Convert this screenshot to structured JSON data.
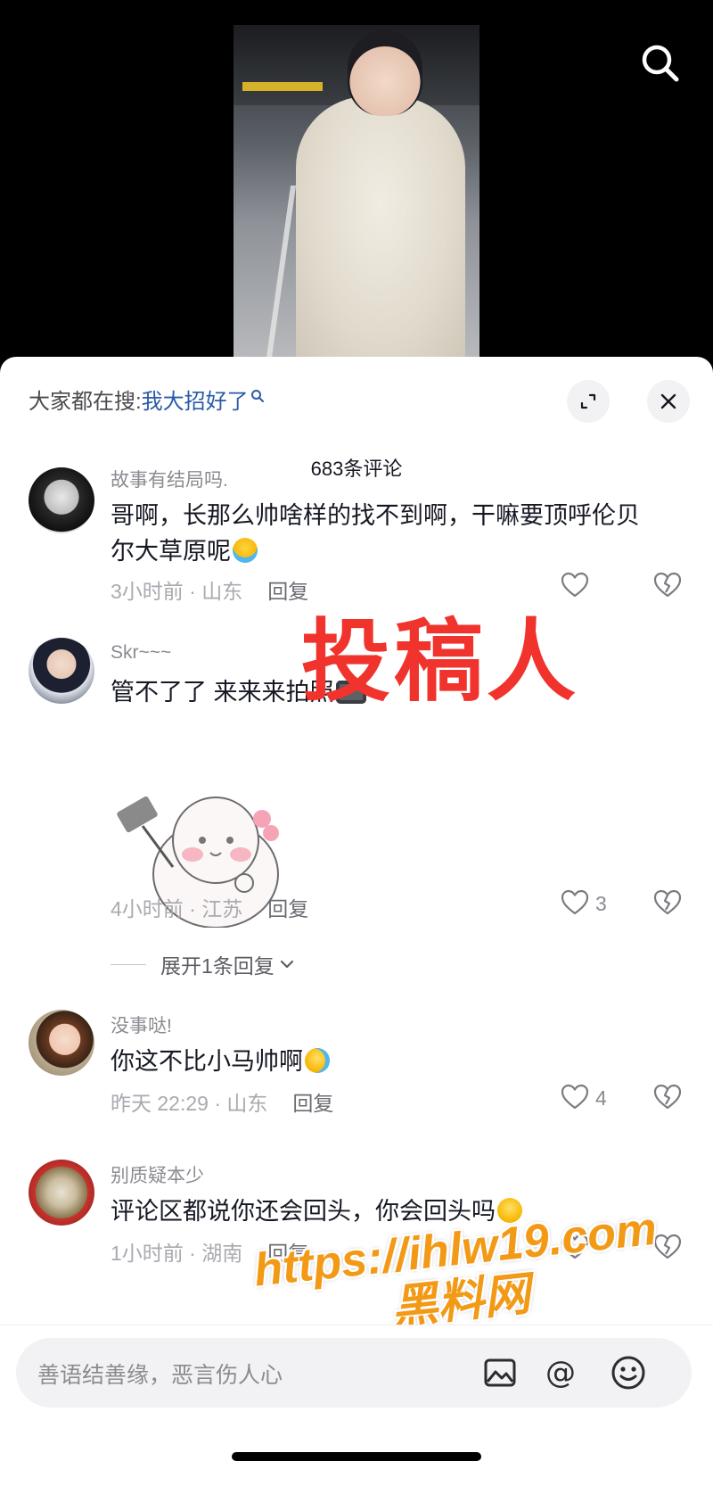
{
  "hot_search": {
    "prefix": "大家都在搜:",
    "query": "我大招好了"
  },
  "comment_count": "683条评论",
  "comments": [
    {
      "username": "故事有结局吗.",
      "text": "哥啊，长那么帅啥样的找不到啊，干嘛要顶呼伦贝尔大草原呢",
      "time_location": "3小时前 · 山东",
      "reply_label": "回复",
      "likes": ""
    },
    {
      "username": "Skr~~~",
      "text": "管不了了 来来来拍照",
      "time_location": "4小时前 · 江苏",
      "reply_label": "回复",
      "likes": "3",
      "expand_replies": "展开1条回复"
    },
    {
      "username": "没事哒!",
      "text": "你这不比小马帅啊",
      "time_location": "昨天 22:29 · 山东",
      "reply_label": "回复",
      "likes": "4"
    },
    {
      "username": "别质疑本少",
      "text": "评论区都说你还会回头，你会回头吗",
      "time_location": "1小时前 · 湖南",
      "reply_label": "回复",
      "likes": ""
    }
  ],
  "input": {
    "placeholder": "善语结善缘，恶言伤人心"
  },
  "overlays": {
    "tougao": "投稿人",
    "url_line1": "https://ihlw19.com",
    "url_line2": "黑料网"
  },
  "colors": {
    "accent_blue": "#2a5ba8",
    "overlay_red": "#f0332c",
    "overlay_orange": "#f29a16"
  }
}
